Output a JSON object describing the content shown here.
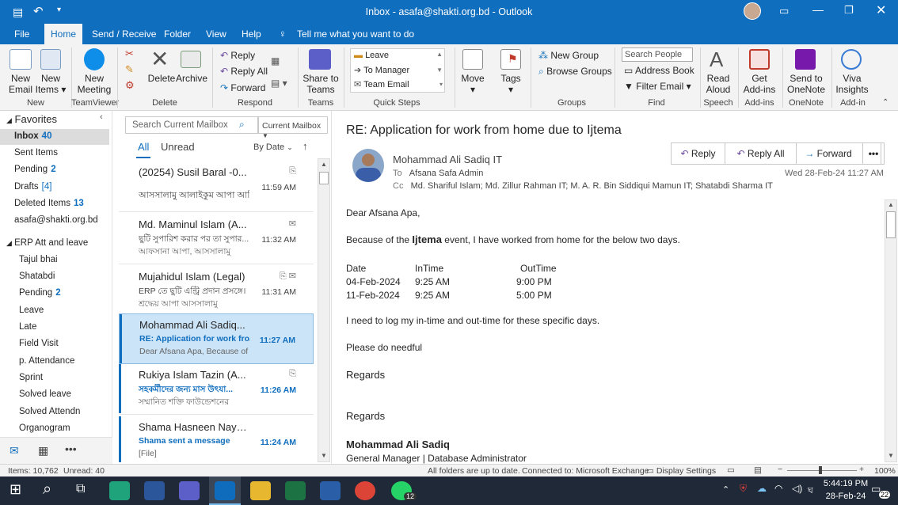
{
  "titlebar": {
    "title": "Inbox - asafa@shakti.org.bd - Outlook"
  },
  "menu": {
    "file": "File",
    "home": "Home",
    "send_receive": "Send / Receive",
    "folder": "Folder",
    "view": "View",
    "help": "Help",
    "tell_me": "Tell me what you want to do"
  },
  "ribbon": {
    "new_email_1": "New",
    "new_email_2": "Email",
    "new_items_1": "New",
    "new_items_2": "Items",
    "new_meeting_1": "New",
    "new_meeting_2": "Meeting",
    "delete": "Delete",
    "archive": "Archive",
    "reply": "Reply",
    "reply_all": "Reply All",
    "forward": "Forward",
    "share_teams_1": "Share to",
    "share_teams_2": "Teams",
    "qs_leave": "Leave",
    "qs_manager": "To Manager",
    "qs_team": "Team Email",
    "move": "Move",
    "tags": "Tags",
    "new_group": "New Group",
    "browse_groups": "Browse Groups",
    "search_people": "Search People",
    "address_book": "Address Book",
    "filter_email": "Filter Email",
    "read_aloud_1": "Read",
    "read_aloud_2": "Aloud",
    "get_addins_1": "Get",
    "get_addins_2": "Add-ins",
    "onenote_1": "Send to",
    "onenote_2": "OneNote",
    "viva_1": "Viva",
    "viva_2": "Insights",
    "groups": {
      "new": "New",
      "teamviewer": "TeamViewer",
      "delete": "Delete",
      "respond": "Respond",
      "teams": "Teams",
      "quicksteps": "Quick Steps",
      "groups": "Groups",
      "find": "Find",
      "speech": "Speech",
      "addins": "Add-ins",
      "onenote": "OneNote",
      "addin": "Add-in"
    }
  },
  "folders": {
    "favorites": "Favorites",
    "items": [
      {
        "label": "Inbox",
        "count": "40"
      },
      {
        "label": "Sent Items",
        "count": ""
      },
      {
        "label": "Pending",
        "count": "2"
      },
      {
        "label": "Drafts",
        "count": "[4]"
      },
      {
        "label": "Deleted Items",
        "count": "13"
      },
      {
        "label": "asafa@shakti.org.bd",
        "count": ""
      }
    ],
    "erp": "ERP Att and leave",
    "sub": [
      "Tajul bhai",
      "Shatabdi",
      "Pending",
      "Leave",
      "Late",
      "Field Visit",
      "p. Attendance",
      "Sprint",
      "Solved leave",
      "Solved Attendn",
      "Organogram"
    ],
    "sub_pending_count": "2"
  },
  "search": {
    "placeholder": "Search Current Mailbox",
    "scope": "Current Mailbox"
  },
  "filters": {
    "all": "All",
    "unread": "Unread",
    "sort": "By Date"
  },
  "messages": [
    {
      "sender": "(20254) Susil Baral -0...",
      "subject": "আসসালামু আলাইকুম আপা আমি",
      "preview": "",
      "time": "11:59 AM"
    },
    {
      "sender": "Md. Maminul Islam (A...",
      "subject": "ছুটি সুপারিশ করার পর তা সুপার...",
      "preview": "আফসানা আপা, আসসালামু",
      "time": "11:32 AM"
    },
    {
      "sender": "Mujahidul Islam (Legal)",
      "subject": "ERP তে ছুটি এন্ট্রি প্রদান প্রসঙ্গে।",
      "preview": "শ্রদ্ধেয় আপা আসসালামু",
      "time": "11:31 AM"
    },
    {
      "sender": "Mohammad Ali Sadiq...",
      "subject": "RE: Application for work fro...",
      "preview": "Dear Afsana Apa,  Because of",
      "time": "11:27 AM"
    },
    {
      "sender": "Rukiya Islam Tazin (A...",
      "subject": "সহকর্মীদের জন্য মাস উৎযা...",
      "preview": "সম্মানিত শক্তি ফাউন্ডেশনের",
      "time": "11:26 AM"
    },
    {
      "sender": "Shama Hasneen Naye...",
      "subject": "Shama sent a message",
      "preview": "[File]",
      "time": "11:24 AM"
    }
  ],
  "email": {
    "subject": "RE: Application for work from home due to Ijtema",
    "from": "Mohammad Ali Sadiq IT",
    "to_label": "To",
    "to": "Afsana Safa Admin",
    "cc_label": "Cc",
    "cc": "Md. Shariful Islam; Md. Zillur Rahman IT; M. A. R. Bin Siddiqui Mamun IT; Shatabdi Sharma IT",
    "date": "Wed 28-Feb-24 11:27 AM",
    "reply": "Reply",
    "reply_all": "Reply All",
    "forward": "Forward",
    "greeting": "Dear Afsana Apa,",
    "line1_a": "Because of the ",
    "line1_b": "Ijtema",
    "line1_c": " event, I have worked from home for the below two days.",
    "table_head": [
      "Date",
      "InTime",
      "OutTime"
    ],
    "table_rows": [
      [
        "04-Feb-2024",
        "9:25 AM",
        "9:00 PM"
      ],
      [
        "11-Feb-2024",
        "9:25 AM",
        "5:00 PM"
      ]
    ],
    "line2": "I need to log my in-time and out-time for these specific days.",
    "line3": "Please do needful",
    "regards1": "Regards",
    "regards2": "Regards",
    "sig_name": "Mohammad Ali  Sadiq",
    "sig_title": "General Manager | Database Administrator"
  },
  "status": {
    "items": "Items: 10,762",
    "unread": "Unread: 40",
    "sync": "All folders are up to date.",
    "connected": "Connected to: Microsoft Exchange",
    "display": "Display Settings",
    "zoom": "100%"
  },
  "taskbar": {
    "time": "5:44:19 PM",
    "date": "28-Feb-24",
    "badge": "12",
    "notif": "22"
  }
}
